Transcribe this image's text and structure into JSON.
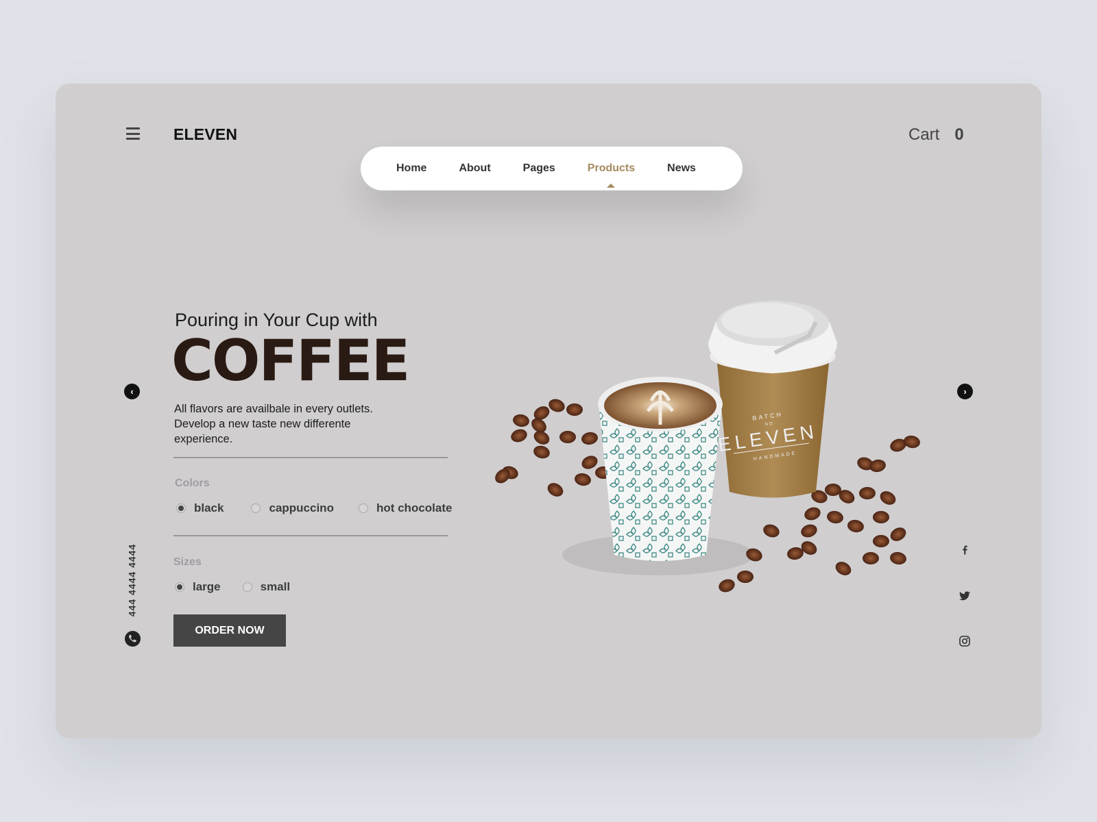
{
  "header": {
    "logo": "ELEVEN",
    "cart_label": "Cart",
    "cart_count": "0"
  },
  "nav": {
    "items": [
      {
        "label": "Home"
      },
      {
        "label": "About"
      },
      {
        "label": "Pages"
      },
      {
        "label": "Products",
        "active": true
      },
      {
        "label": "News"
      }
    ],
    "accent": "#a48a5e"
  },
  "hero": {
    "subtitle": "Pouring in Your Cup with",
    "title": "COFFEE",
    "description": "All flavors are availbale in every outlets. Develop a new taste new differente experience."
  },
  "colors": {
    "label": "Colors",
    "options": [
      "black",
      "cappuccino",
      "hot chocolate"
    ],
    "selected": "black"
  },
  "sizes": {
    "label": "Sizes",
    "options": [
      "large",
      "small"
    ],
    "selected": "large"
  },
  "order_button": "ORDER NOW",
  "contact": {
    "phone": "444 4444 4444"
  },
  "social": [
    "facebook-icon",
    "twitter-icon",
    "instagram-icon"
  ],
  "product_image": {
    "cup_print": "BATCH NO ELEVEN HANDMADE"
  }
}
